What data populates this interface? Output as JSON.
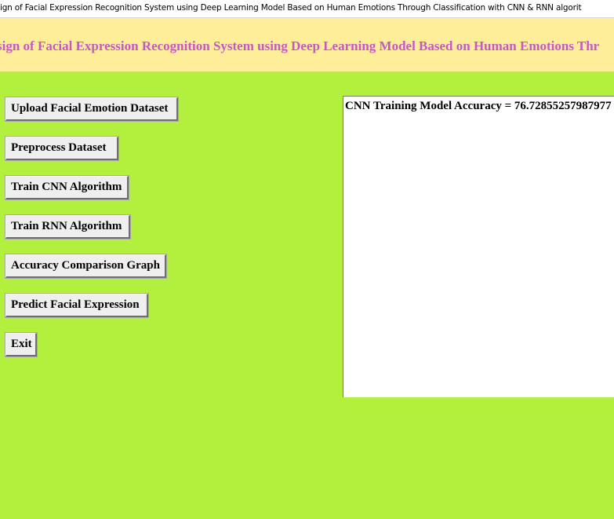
{
  "window": {
    "title": "ign of  Facial Expression Recognition System using Deep Learning Model Based on Human Emotions Through Classification with CNN & RNN algorit"
  },
  "header": {
    "text": "sign of  Facial Expression Recognition System using Deep Learning Model Based on Human Emotions Thr"
  },
  "buttons": {
    "upload": "Upload Facial Emotion Dataset",
    "preprocess": "Preprocess Dataset",
    "train_cnn": "Train CNN Algorithm",
    "train_rnn": "Train RNN Algorithm",
    "comparison": "Accuracy Comparison Graph",
    "predict": "Predict Facial Expression",
    "exit": "Exit"
  },
  "output": {
    "text": "CNN Training Model Accuracy = 76.72855257987977"
  },
  "colors": {
    "background": "#b3ef3d",
    "header_band": "#ffee99",
    "header_text": "#c657c9"
  }
}
